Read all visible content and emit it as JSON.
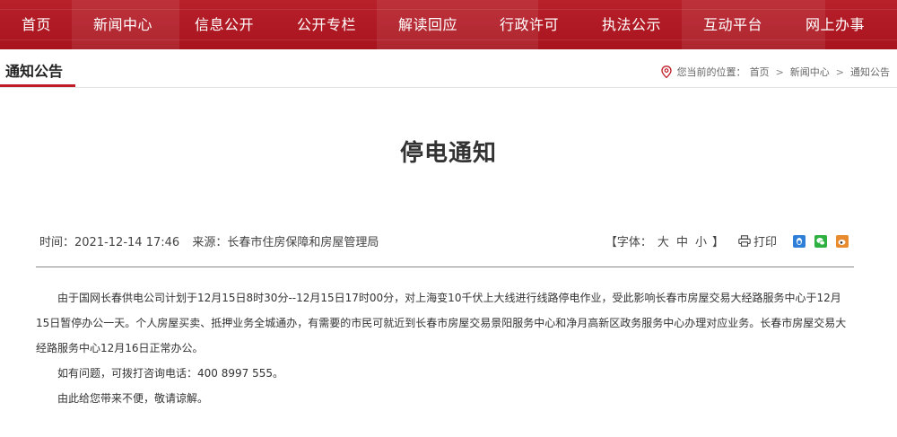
{
  "nav": {
    "items": [
      "首页",
      "新闻中心",
      "信息公开",
      "公开专栏",
      "解读回应",
      "行政许可",
      "执法公示",
      "互动平台",
      "网上办事"
    ]
  },
  "section": {
    "title": "通知公告"
  },
  "breadcrumb": {
    "prefix": "您当前的位置：",
    "items": [
      "首页",
      "新闻中心",
      "通知公告"
    ],
    "separator": ">"
  },
  "article": {
    "title": "停电通知",
    "time_label": "时间：",
    "time": "2021-12-14 17:46",
    "source_label": "来源：",
    "source": "长春市住房保障和房屋管理局",
    "font_label_open": "【字体：",
    "font_sizes": [
      "大",
      "中",
      "小"
    ],
    "font_label_close": "】",
    "print_label": "打印",
    "paragraphs": [
      "由于国网长春供电公司计划于12月15日8时30分--12月15日17时00分，对上海变10千伏上大线进行线路停电作业，受此影响长春市房屋交易大经路服务中心于12月15日暂停办公一天。个人房屋买卖、抵押业务全城通办，有需要的市民可就近到长春市房屋交易景阳服务中心和净月高新区政务服务中心办理对应业务。长春市房屋交易大经路服务中心12月16日正常办公。",
      "如有问题，可拨打咨询电话：400 8997 555。",
      "由此给您带来不便，敬请谅解。"
    ]
  },
  "colors": {
    "nav_bg": "#b01a24",
    "accent": "#c01a24"
  }
}
